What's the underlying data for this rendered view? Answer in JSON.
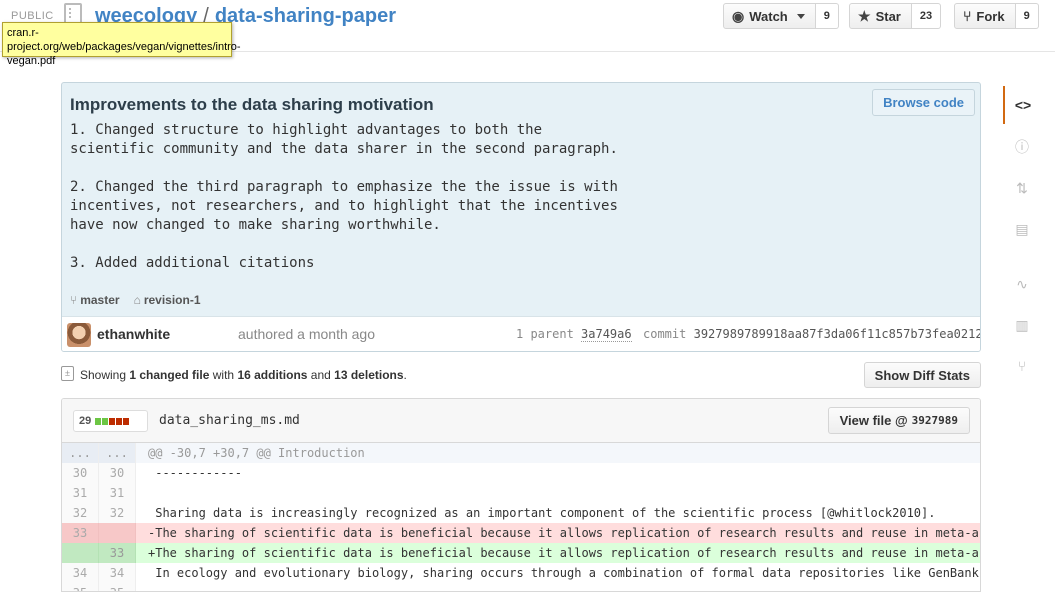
{
  "header": {
    "public_label": "PUBLIC",
    "owner": "weecology",
    "separator": "/",
    "repo": "data-sharing-paper",
    "watch_label": "Watch",
    "watch_count": "9",
    "star_label": "Star",
    "star_count": "23",
    "fork_label": "Fork",
    "fork_count": "9"
  },
  "tooltip": {
    "text": "cran.r-project.org/web/packages/vegan/vignettes/intro-vegan.pdf"
  },
  "sidebar": {
    "items": [
      {
        "name": "code-icon",
        "glyph": "<>"
      },
      {
        "name": "issues-icon",
        "glyph": "ⓘ"
      },
      {
        "name": "pull-requests-icon",
        "glyph": "⇅"
      },
      {
        "name": "wiki-icon",
        "glyph": "▤"
      },
      {
        "name": "pulse-icon",
        "glyph": "∿"
      },
      {
        "name": "graphs-icon",
        "glyph": "▥"
      },
      {
        "name": "network-icon",
        "glyph": "⑂"
      }
    ]
  },
  "commit": {
    "title": "Improvements to the data sharing motivation",
    "browse_label": "Browse code",
    "description": "1. Changed structure to highlight advantages to both the\nscientific community and the data sharer in the second paragraph.\n\n2. Changed the third paragraph to emphasize the the issue is with\nincentives, not researchers, and to highlight that the incentives\nhave now changed to make sharing worthwhile.\n\n3. Added additional citations",
    "branch": "master",
    "tag": "revision-1",
    "author": "ethanwhite",
    "authored": "authored a month ago",
    "parent_label": "1 parent",
    "parent_sha": "3a749a6",
    "commit_label": "commit",
    "commit_sha": "3927989789918aa87f3da06f11c857b73fea0212"
  },
  "toc": {
    "showing": "Showing",
    "changed": "1 changed file",
    "with": "with",
    "additions": "16 additions",
    "and": "and",
    "deletions": "13 deletions",
    "period": ".",
    "diffstat_label": "Show Diff Stats"
  },
  "file": {
    "stat_count": "29",
    "name": "data_sharing_ms.md",
    "view_label": "View file @",
    "view_sha": "3927989",
    "rows": [
      {
        "type": "hunk",
        "left": "...",
        "right": "...",
        "code": "@@ -30,7 +30,7 @@ Introduction"
      },
      {
        "type": "ctx",
        "left": "30",
        "right": "30",
        "code": " ------------"
      },
      {
        "type": "ctx",
        "left": "31",
        "right": "31",
        "code": " "
      },
      {
        "type": "ctx",
        "left": "32",
        "right": "32",
        "code": " Sharing data is increasingly recognized as an important component of the scientific process [@whitlock2010]."
      },
      {
        "type": "del",
        "left": "33",
        "right": "",
        "code": "-The sharing of scientific data is beneficial because it allows replication of research results and reuse in meta-analy"
      },
      {
        "type": "add",
        "left": "",
        "right": "33",
        "code": "+The sharing of scientific data is beneficial because it allows replication of research results and reuse in meta-analy"
      },
      {
        "type": "ctx",
        "left": "34",
        "right": "34",
        "code": " In ecology and evolutionary biology, sharing occurs through a combination of formal data repositories like GenBank ([h"
      },
      {
        "type": "ctx",
        "left": "35",
        "right": "35",
        "code": " "
      }
    ]
  }
}
